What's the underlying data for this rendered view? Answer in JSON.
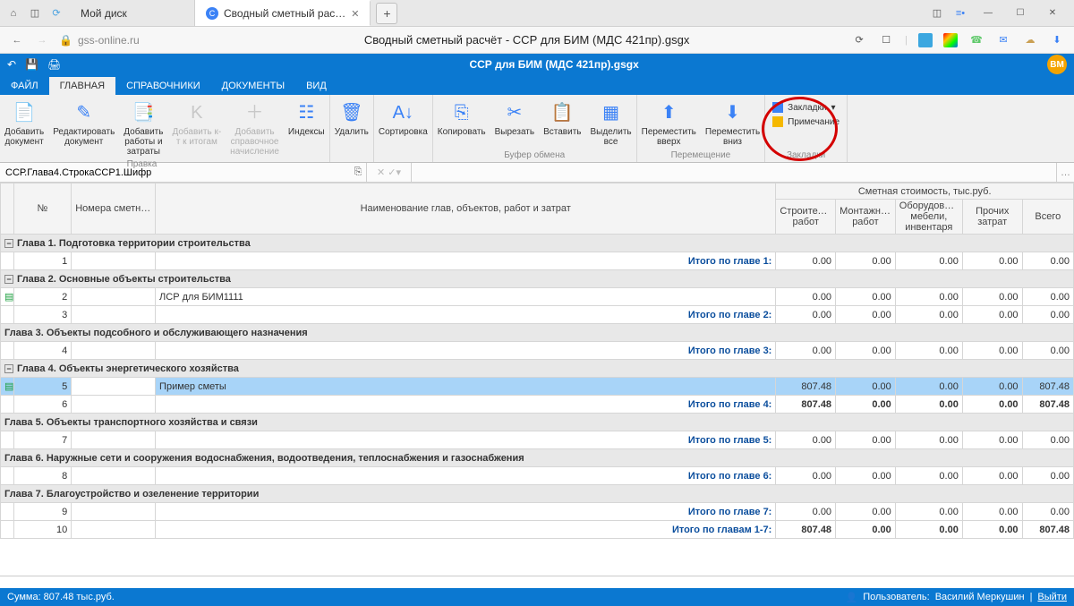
{
  "browser": {
    "tab1": "Мой диск",
    "tab2": "Сводный сметный рас…",
    "url": "gss-online.ru",
    "page_title": "Сводный сметный расчёт - ССР для БИМ (МДС 421пр).gsgx"
  },
  "app": {
    "title": "ССР для БИМ (МДС 421пр).gsgx",
    "user_badge": "ВМ",
    "tabs": {
      "file": "ФАЙЛ",
      "home": "ГЛАВНАЯ",
      "ref": "СПРАВОЧНИКИ",
      "doc": "ДОКУМЕНТЫ",
      "view": "ВИД"
    }
  },
  "ribbon": {
    "add_doc": "Добавить\nдокумент",
    "edit_doc": "Редактировать\nдокумент",
    "add_wz": "Добавить\nработы и\nзатраты",
    "add_ki": "Добавить к-\nт к итогам",
    "add_sn": "Добавить\nсправочное\nначисление",
    "grp_pravka": "Правка",
    "indexes": "Индексы",
    "delete": "Удалить",
    "sort": "Сортировка",
    "copy": "Копировать",
    "cut": "Вырезать",
    "paste": "Вставить",
    "select_all": "Выделить\nвсе",
    "grp_buf": "Буфер обмена",
    "move_up": "Переместить\nвверх",
    "move_dn": "Переместить\nвниз",
    "grp_move": "Перемещение",
    "bookmarks": "Закладки",
    "note": "Примечание",
    "grp_bm": "Закладки"
  },
  "fbar": {
    "path": "ССР.Глава4.СтрокаССР1.Шифр"
  },
  "table": {
    "cost_head": "Сметная стоимость, тыс.руб.",
    "cols": {
      "no": "№",
      "nums": "Номера сметных расчетов и смет",
      "name": "Наименование глав, объектов, работ и затрат",
      "stroit": "Строительных работ",
      "montazh": "Монтажных работ",
      "oborud": "Оборудования, мебели, инвентаря",
      "prochih": "Прочих затрат",
      "vsego": "Всего"
    },
    "g1": "Глава 1. Подготовка территории строительства",
    "g2": "Глава 2. Основные объекты строительства",
    "g3": "Глава 3. Объекты подсобного и обслуживающего назначения",
    "g4": "Глава 4. Объекты энергетического хозяйства",
    "g5": "Глава 5. Объекты транспортного хозяйства и связи",
    "g6": "Глава 6. Наружные сети и сооружения водоснабжения, водоотведения, теплоснабжения и газоснабжения",
    "g7": "Глава 7. Благоустройство и озеленение территории",
    "it1": "Итого по главе 1:",
    "it2": "Итого по главе 2:",
    "it3": "Итого по главе 3:",
    "it4": "Итого по главе 4:",
    "it5": "Итого по главе 5:",
    "it6": "Итого по главе 6:",
    "it7": "Итого по главе 7:",
    "it17": "Итого по главам 1-7:",
    "row2name": "ЛСР для БИМ1111",
    "row5name": "Пример сметы",
    "z": "0.00",
    "v807": "807.48"
  },
  "status": {
    "sum": "Сумма: 807.48 тыс.руб.",
    "user_lbl": "Пользователь:",
    "user": "Василий Меркушин",
    "logout": "Выйти"
  }
}
